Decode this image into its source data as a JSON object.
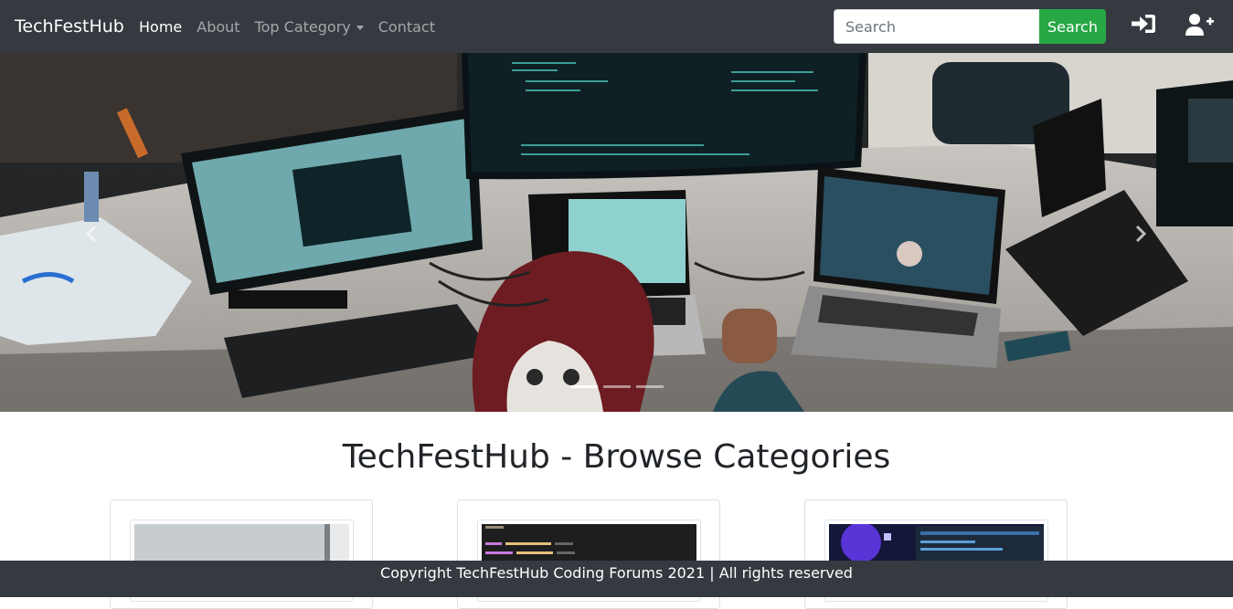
{
  "navbar": {
    "brand": "TechFestHub",
    "links": [
      {
        "label": "Home",
        "active": true
      },
      {
        "label": "About",
        "active": false
      },
      {
        "label": "Top Category",
        "active": false,
        "dropdown": true
      },
      {
        "label": "Contact",
        "active": false
      }
    ],
    "search": {
      "placeholder": "Search",
      "button_label": "Search"
    },
    "icons": {
      "login": "sign-in-icon",
      "signup": "user-plus-icon"
    }
  },
  "carousel": {
    "indicator_count": 3,
    "active_index": 0,
    "icons": {
      "prev": "chevron-left-icon",
      "next": "chevron-right-icon"
    }
  },
  "main": {
    "title": "TechFestHub - Browse Categories"
  },
  "footer": {
    "text": "Copyright TechFestHub Coding Forums 2021 | All rights reserved"
  },
  "colors": {
    "navbar": "#343a40",
    "accent_success": "#28a745"
  }
}
